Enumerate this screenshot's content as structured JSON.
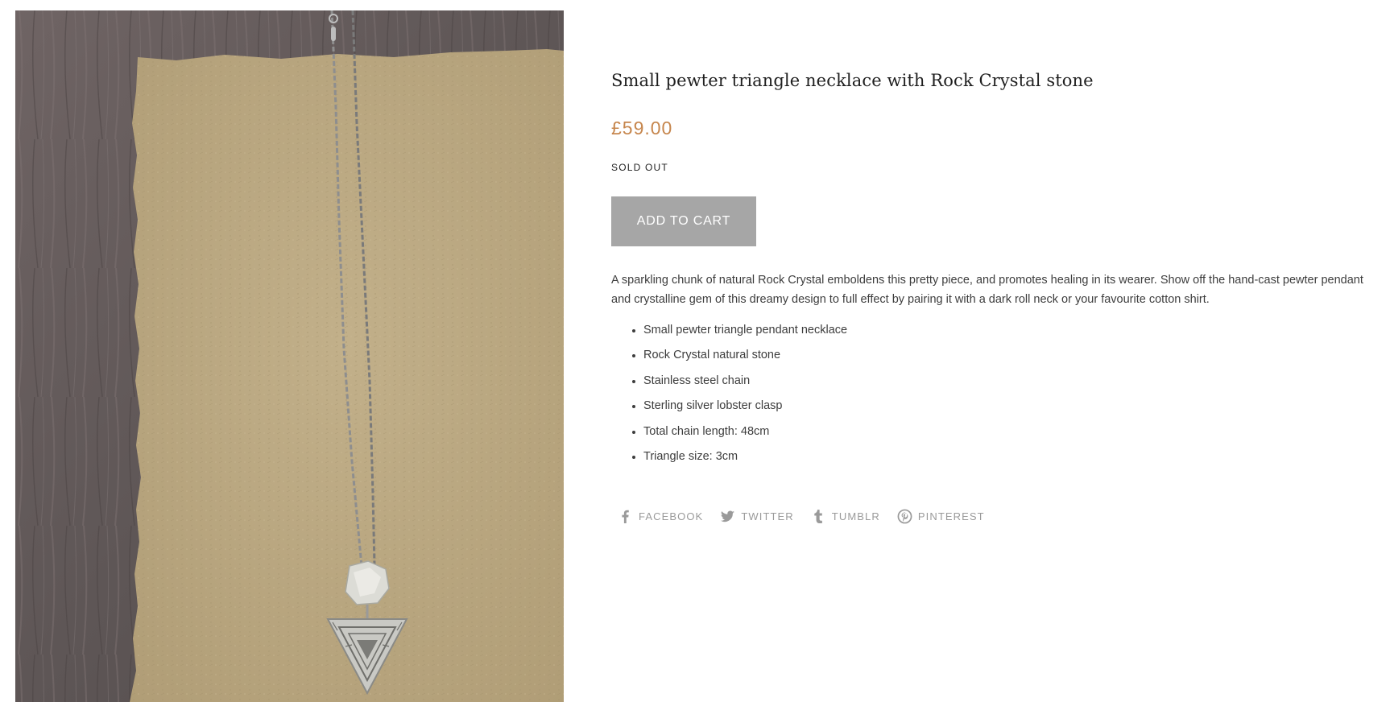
{
  "product": {
    "title": "Small pewter triangle necklace with Rock Crystal stone",
    "price": "£59.00",
    "stock_status": "SOLD OUT",
    "add_to_cart_label": "ADD TO CART",
    "image_alt": "Small pewter triangle necklace with Rock Crystal stone",
    "description": "A sparkling chunk of natural Rock Crystal emboldens this pretty piece, and promotes healing in its wearer. Show off the hand-cast pewter pendant and crystalline gem of this dreamy design to full effect by pairing it with a dark roll neck or your favourite cotton shirt.",
    "features": [
      "Small pewter triangle pendant necklace",
      "Rock Crystal natural stone",
      "Stainless steel chain",
      "Sterling silver lobster clasp",
      "Total chain length: 48cm",
      "Triangle size: 3cm"
    ]
  },
  "share": [
    {
      "label": "FACEBOOK",
      "icon": "facebook-icon"
    },
    {
      "label": "TWITTER",
      "icon": "twitter-icon"
    },
    {
      "label": "TUMBLR",
      "icon": "tumblr-icon"
    },
    {
      "label": "PINTEREST",
      "icon": "pinterest-icon"
    }
  ],
  "colors": {
    "price": "#c6864d",
    "button": "#a6a6a6",
    "share": "#9a9a9a",
    "title": "#1f1f1f"
  }
}
